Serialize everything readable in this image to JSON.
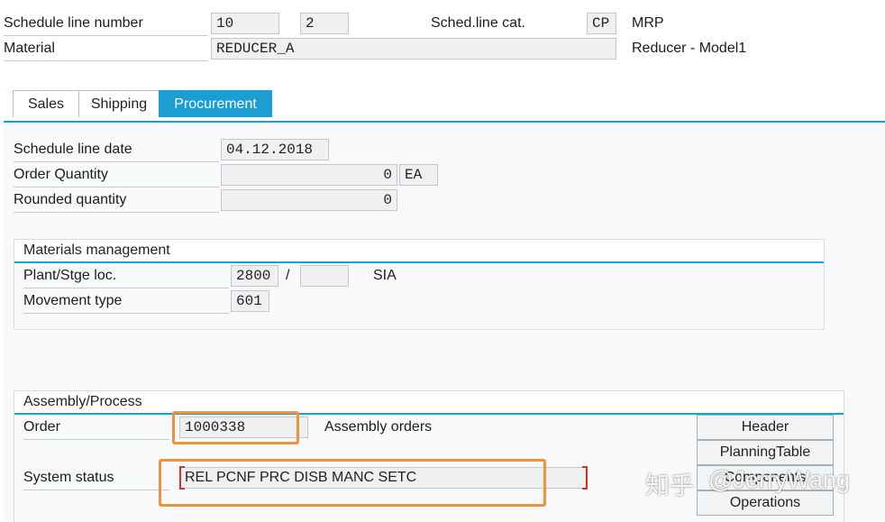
{
  "header": {
    "schedule_line_label": "Schedule line number",
    "schedule_line_value": "10",
    "schedule_line_value2": "2",
    "sched_cat_label": "Sched.line cat.",
    "sched_cat_value": "CP",
    "sched_cat_desc": "MRP",
    "material_label": "Material",
    "material_value": "REDUCER_A",
    "material_desc": "Reducer - Model1"
  },
  "tabs": [
    {
      "label": "Sales",
      "active": false
    },
    {
      "label": "Shipping",
      "active": false
    },
    {
      "label": "Procurement",
      "active": true
    }
  ],
  "procurement": {
    "schedule_date_label": "Schedule line date",
    "schedule_date_value": "04.12.2018",
    "order_qty_label": "Order Quantity",
    "order_qty_value": "0",
    "order_qty_unit": "EA",
    "rounded_qty_label": "Rounded quantity",
    "rounded_qty_value": "0"
  },
  "materials_mgmt": {
    "title": "Materials management",
    "plant_label": "Plant/Stge loc.",
    "plant_value": "2800",
    "separator": "/",
    "storage_value": "",
    "plant_desc": "SIA",
    "movement_label": "Movement type",
    "movement_value": "601"
  },
  "assembly": {
    "title": "Assembly/Process",
    "order_label": "Order",
    "order_value": "1000338",
    "order_desc": "Assembly orders",
    "status_label": "System status",
    "status_value": "REL  PCNF PRC  DISB MANC SETC",
    "buttons": [
      "Header",
      "PlanningTable",
      "Components",
      "Operations"
    ]
  },
  "watermark": {
    "cn_text": "知乎",
    "user_text": "@JerryWang"
  },
  "colors": {
    "accent": "#1a9ed4",
    "highlight": "#f0923a",
    "bracket": "#d83020"
  }
}
